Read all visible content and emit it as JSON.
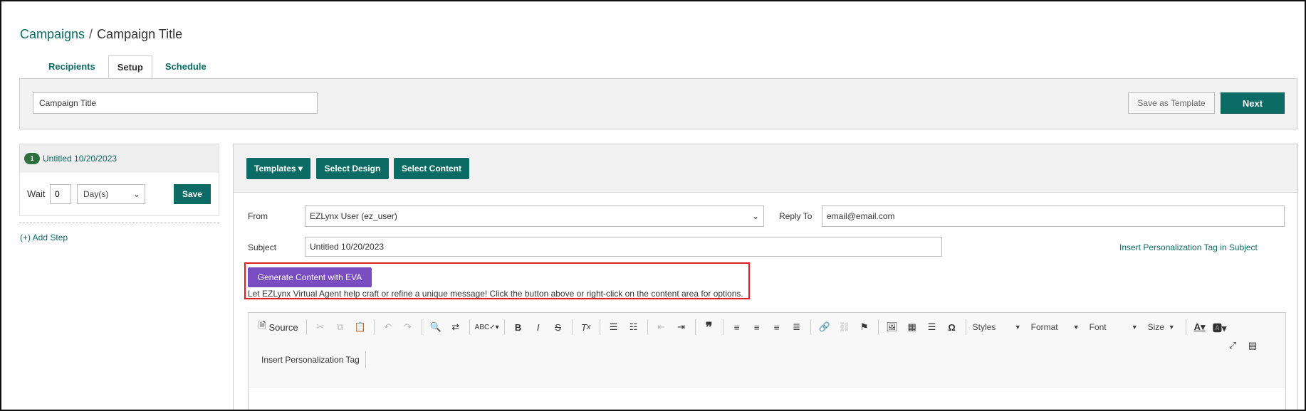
{
  "breadcrumb": {
    "parent": "Campaigns",
    "separator": "/",
    "current": "Campaign Title"
  },
  "tabs": [
    {
      "label": "Recipients",
      "active": false
    },
    {
      "label": "Setup",
      "active": true
    },
    {
      "label": "Schedule",
      "active": false
    }
  ],
  "title_panel": {
    "title_value": "Campaign Title",
    "save_template_label": "Save as Template",
    "next_label": "Next"
  },
  "step": {
    "number": "1",
    "name": "Untitled 10/20/2023",
    "wait_label": "Wait",
    "wait_value": "0",
    "unit_value": "Day(s)",
    "save_label": "Save",
    "add_step_label": "(+) Add Step"
  },
  "editor": {
    "templates_label": "Templates",
    "select_design_label": "Select Design",
    "select_content_label": "Select Content",
    "from_label": "From",
    "from_value": "EZLynx User (ez_user)",
    "reply_to_label": "Reply To",
    "reply_to_value": "email@email.com",
    "subject_label": "Subject",
    "subject_value": "Untitled 10/20/2023",
    "insert_tag_subject_label": "Insert Personalization Tag in Subject",
    "eva_button_label": "Generate Content with EVA",
    "eva_help_text": "Let EZLynx Virtual Agent help craft or refine a unique message! Click the button above or right-click on the content area for options."
  },
  "toolbar": {
    "source_label": "Source",
    "styles_label": "Styles",
    "format_label": "Format",
    "font_label": "Font",
    "size_label": "Size",
    "insert_tag_label": "Insert Personalization Tag"
  },
  "colors": {
    "accent": "#0c6b64",
    "eva": "#7a4cc2",
    "highlight": "#e02020"
  }
}
